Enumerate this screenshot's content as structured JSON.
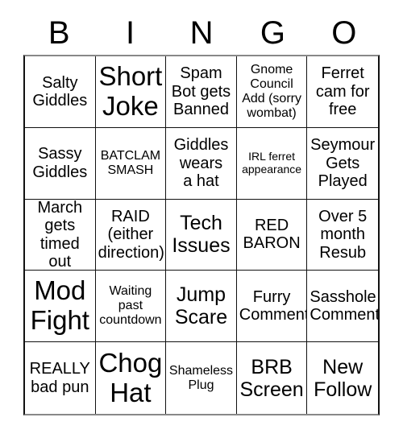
{
  "card": {
    "header_letters": [
      "B",
      "I",
      "N",
      "G",
      "O"
    ],
    "background_color": "#ffffff",
    "text_color": "#000000",
    "border_color": "#111111",
    "columns": 5,
    "rows": 5,
    "cells": [
      {
        "text": "Salty\nGiddles",
        "size": "md"
      },
      {
        "text": "Short\nJoke",
        "size": "xl"
      },
      {
        "text": "Spam\nBot gets\nBanned",
        "size": "md"
      },
      {
        "text": "Gnome\nCouncil\nAdd (sorry\nwombat)",
        "size": "sm"
      },
      {
        "text": "Ferret\ncam for\nfree",
        "size": "md"
      },
      {
        "text": "Sassy\nGiddles",
        "size": "md"
      },
      {
        "text": "BATCLAM\nSMASH",
        "size": "sm"
      },
      {
        "text": "Giddles\nwears\na hat",
        "size": "md"
      },
      {
        "text": "IRL ferret\nappearance",
        "size": "xs"
      },
      {
        "text": "Seymour\nGets\nPlayed",
        "size": "md"
      },
      {
        "text": "March\ngets\ntimed out",
        "size": "md"
      },
      {
        "text": "RAID\n(either\ndirection)",
        "size": "md"
      },
      {
        "text": "Tech\nIssues",
        "size": "lg"
      },
      {
        "text": "RED\nBARON",
        "size": "md"
      },
      {
        "text": "Over 5\nmonth\nResub",
        "size": "md"
      },
      {
        "text": "Mod\nFight",
        "size": "xl"
      },
      {
        "text": "Waiting\npast\ncountdown",
        "size": "sm"
      },
      {
        "text": "Jump\nScare",
        "size": "lg"
      },
      {
        "text": "Furry\nComment",
        "size": "md"
      },
      {
        "text": "Sasshole\nComment",
        "size": "md"
      },
      {
        "text": "REALLY\nbad pun",
        "size": "md"
      },
      {
        "text": "Chog\nHat",
        "size": "xl"
      },
      {
        "text": "Shameless\nPlug",
        "size": "sm"
      },
      {
        "text": "BRB\nScreen",
        "size": "lg"
      },
      {
        "text": "New\nFollow",
        "size": "lg"
      }
    ]
  }
}
